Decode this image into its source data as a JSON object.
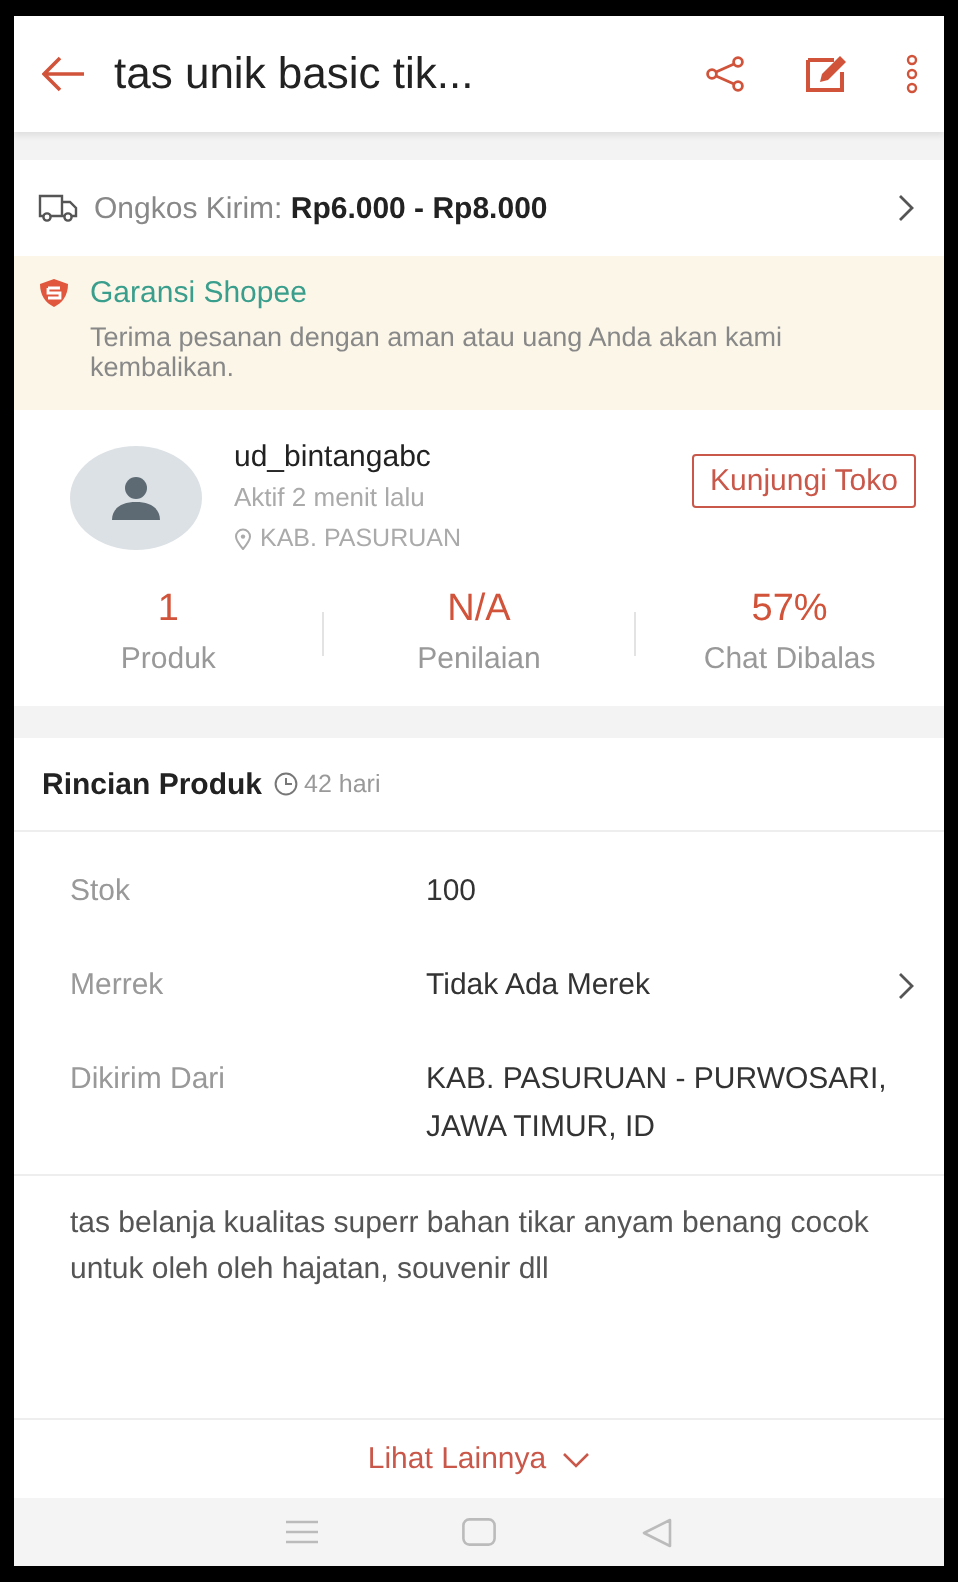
{
  "header": {
    "title": "tas unik basic tik..."
  },
  "shipping": {
    "label": "Ongkos Kirim:",
    "price": "Rp6.000 - Rp8.000"
  },
  "guarantee": {
    "title": "Garansi Shopee",
    "text": "Terima pesanan dengan aman atau uang Anda akan kami kembalikan."
  },
  "seller": {
    "name": "ud_bintangabc",
    "status": "Aktif 2 menit lalu",
    "location": "KAB. PASURUAN",
    "button": "Kunjungi Toko"
  },
  "stats": [
    {
      "value": "1",
      "label": "Produk"
    },
    {
      "value": "N/A",
      "label": "Penilaian"
    },
    {
      "value": "57%",
      "label": "Chat Dibalas"
    }
  ],
  "details": {
    "title": "Rincian Produk",
    "age": "42 hari"
  },
  "specs": [
    {
      "label": "Stok",
      "value": "100",
      "has_arrow": false
    },
    {
      "label": "Merrek",
      "value": "Tidak Ada Merek",
      "has_arrow": true
    },
    {
      "label": "Dikirim Dari",
      "value": "KAB. PASURUAN - PURWOSARI, JAWA TIMUR, ID",
      "has_arrow": false
    }
  ],
  "description": "tas belanja kualitas superr bahan tikar anyam benang cocok untuk oleh oleh hajatan, souvenir dll",
  "more_button": "Lihat Lainnya"
}
